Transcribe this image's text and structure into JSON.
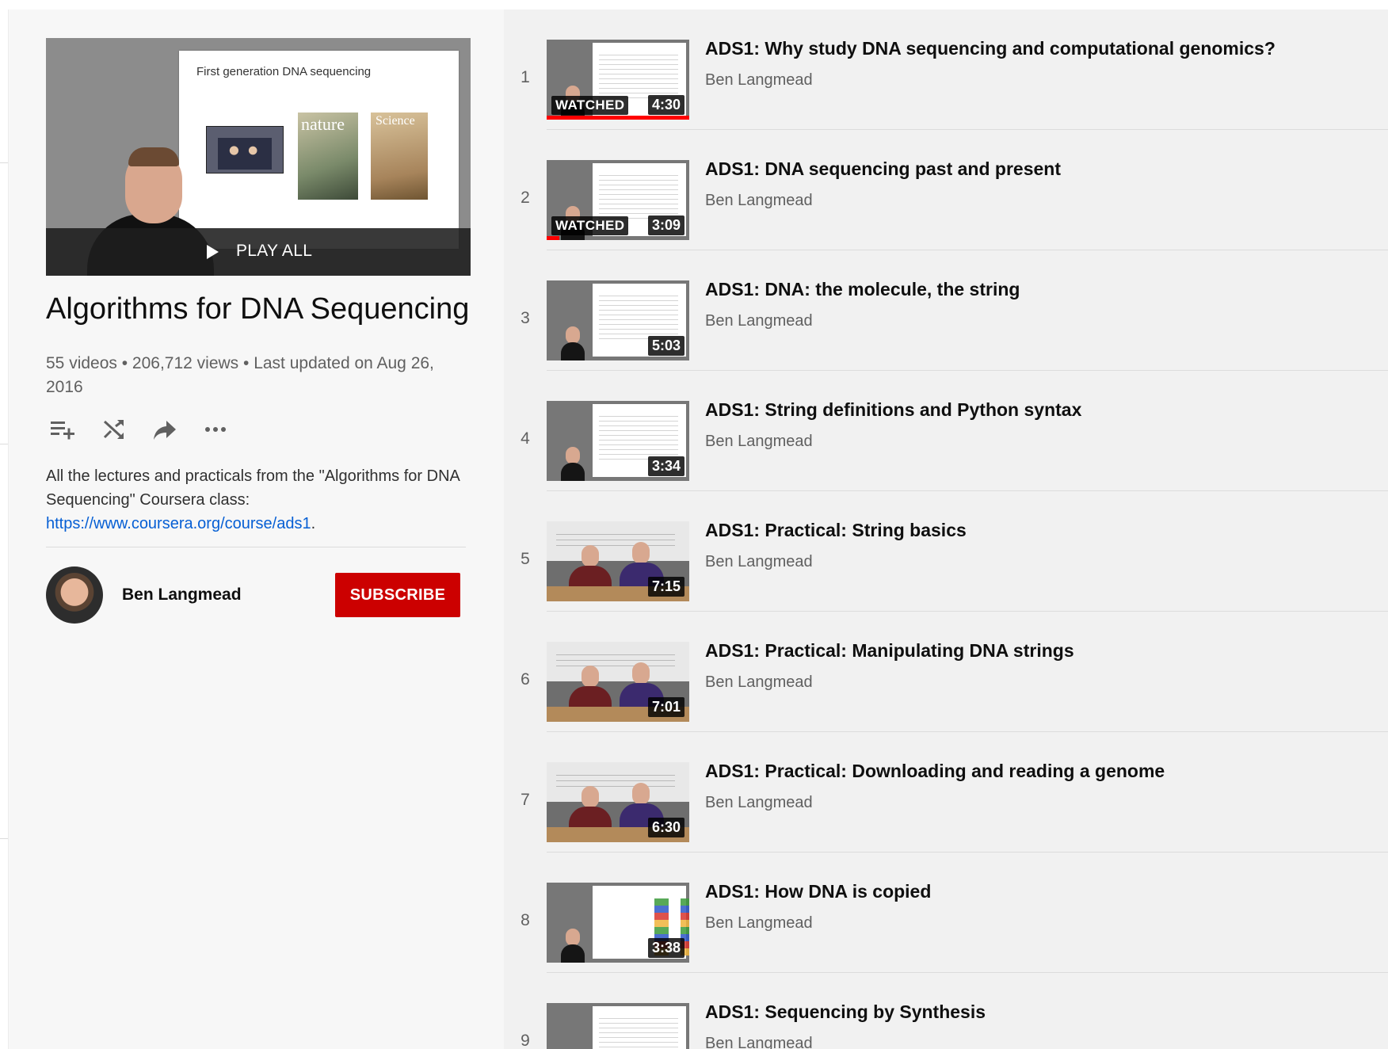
{
  "playlist": {
    "play_all_label": "PLAY ALL",
    "hero_slide_title": "First generation DNA sequencing",
    "hero_magazine_1": "nature",
    "hero_magazine_2": "Science",
    "title": "Algorithms for DNA Sequencing",
    "stats": "55 videos • 206,712 views • Last updated on Aug 26, 2016",
    "description_text": "All the lectures and practicals from the \"Algorithms for DNA Sequencing\" Coursera class: ",
    "description_link": "https://www.coursera.org/course/ads1",
    "description_end": ".",
    "actions": [
      "add-to-queue-icon",
      "shuffle-icon",
      "share-icon",
      "more-icon"
    ]
  },
  "owner": {
    "name": "Ben Langmead",
    "subscribe_label": "SUBSCRIBE"
  },
  "colors": {
    "subscribe": "#cc0000",
    "link": "#065fd4",
    "progress": "#ff0000",
    "panel_bg": "#f7f7f7",
    "list_bg": "#f1f1f1"
  },
  "videos": [
    {
      "index": "1",
      "title": "ADS1: Why study DNA sequencing and computational genomics?",
      "channel": "Ben Langmead",
      "duration": "4:30",
      "watched": "WATCHED",
      "progress": 1.0,
      "thumb": "lecture"
    },
    {
      "index": "2",
      "title": "ADS1: DNA sequencing past and present",
      "channel": "Ben Langmead",
      "duration": "3:09",
      "watched": "WATCHED",
      "progress": 0.09,
      "thumb": "lecture"
    },
    {
      "index": "3",
      "title": "ADS1: DNA: the molecule, the string",
      "channel": "Ben Langmead",
      "duration": "5:03",
      "watched": "",
      "progress": 0,
      "thumb": "lecture"
    },
    {
      "index": "4",
      "title": "ADS1: String definitions and Python syntax",
      "channel": "Ben Langmead",
      "duration": "3:34",
      "watched": "",
      "progress": 0,
      "thumb": "lecture"
    },
    {
      "index": "5",
      "title": "ADS1: Practical: String basics",
      "channel": "Ben Langmead",
      "duration": "7:15",
      "watched": "",
      "progress": 0,
      "thumb": "practical"
    },
    {
      "index": "6",
      "title": "ADS1: Practical: Manipulating DNA strings",
      "channel": "Ben Langmead",
      "duration": "7:01",
      "watched": "",
      "progress": 0,
      "thumb": "practical"
    },
    {
      "index": "7",
      "title": "ADS1: Practical: Downloading and reading a genome",
      "channel": "Ben Langmead",
      "duration": "6:30",
      "watched": "",
      "progress": 0,
      "thumb": "practical"
    },
    {
      "index": "8",
      "title": "ADS1: How DNA is copied",
      "channel": "Ben Langmead",
      "duration": "3:38",
      "watched": "",
      "progress": 0,
      "thumb": "dna"
    },
    {
      "index": "9",
      "title": "ADS1: Sequencing by Synthesis",
      "channel": "Ben Langmead",
      "duration": "",
      "watched": "",
      "progress": 0,
      "thumb": "lecture"
    }
  ]
}
